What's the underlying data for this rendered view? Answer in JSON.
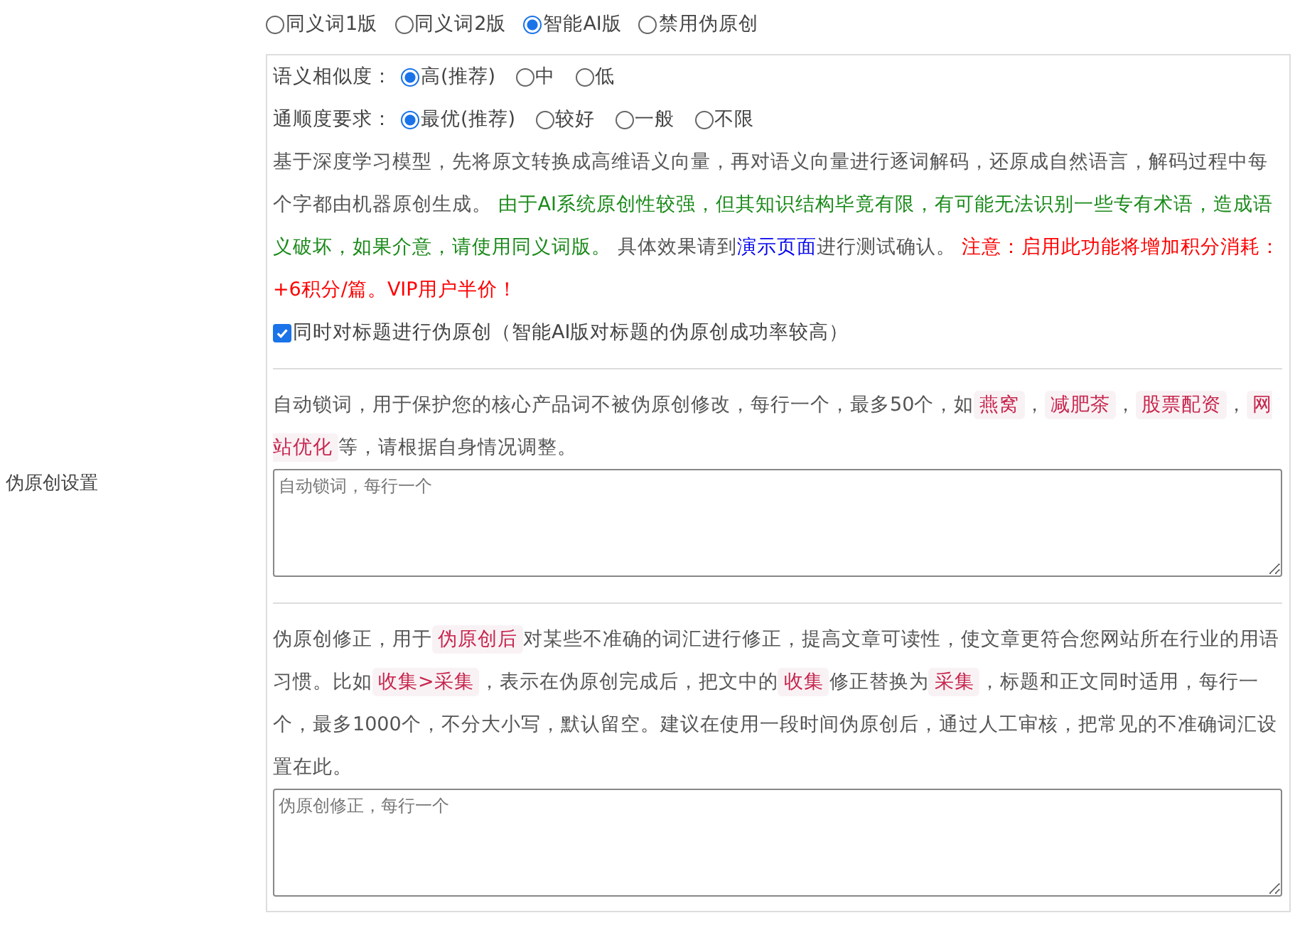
{
  "modes": [
    {
      "label": "同义词1版",
      "selected": false
    },
    {
      "label": "同义词2版",
      "selected": false
    },
    {
      "label": "智能AI版",
      "selected": true
    },
    {
      "label": "禁用伪原创",
      "selected": false
    }
  ],
  "similarity": {
    "label": "语义相似度：",
    "options": [
      {
        "label": "高(推荐)",
        "selected": true
      },
      {
        "label": "中",
        "selected": false
      },
      {
        "label": "低",
        "selected": false
      }
    ]
  },
  "fluency": {
    "label": "通顺度要求：",
    "options": [
      {
        "label": "最优(推荐)",
        "selected": true
      },
      {
        "label": "较好",
        "selected": false
      },
      {
        "label": "一般",
        "selected": false
      },
      {
        "label": "不限",
        "selected": false
      }
    ]
  },
  "description": [
    {
      "kind": "plain",
      "text": "基于深度学习模型，先将原文转换成高维语义向量，再对语义向量进行逐词解码，还原成自然语言，解码过程中每个字都由机器原创生成。 "
    },
    {
      "kind": "notice",
      "text": "由于AI系统原创性较强，但其知识结构毕竟有限，有可能无法识别一些专有术语，造成语义破坏，如果介意，请使用同义词版。"
    },
    {
      "kind": "plain",
      "text": " 具体效果请到"
    },
    {
      "kind": "link",
      "text": "演示页面"
    },
    {
      "kind": "plain",
      "text": "进行测试确认。 "
    },
    {
      "kind": "warning",
      "text": "注意：启用此功能将增加积分消耗：+6积分/篇。VIP用户半价！"
    }
  ],
  "title_option": {
    "label": "同时对标题进行伪原创（智能AI版对标题的伪原创成功率较高）",
    "checked": true
  },
  "settings_label": "伪原创设置",
  "lock_words": {
    "segments": [
      {
        "kind": "text",
        "text": "自动锁词，用于保护您的核心产品词不被伪原创修改，每行一个，最多50个，如"
      },
      {
        "kind": "tag",
        "text": "燕窝"
      },
      {
        "kind": "text",
        "text": "，"
      },
      {
        "kind": "tag",
        "text": "减肥茶"
      },
      {
        "kind": "text",
        "text": "，"
      },
      {
        "kind": "tag",
        "text": "股票配资"
      },
      {
        "kind": "text",
        "text": "，"
      },
      {
        "kind": "tag",
        "text": "网站优化"
      },
      {
        "kind": "text",
        "text": "等，请根据自身情况调整。"
      }
    ],
    "placeholder": "自动锁词，每行一个"
  },
  "corrections": {
    "segments": [
      {
        "kind": "text",
        "text": "伪原创修正，用于"
      },
      {
        "kind": "tag",
        "text": "伪原创后"
      },
      {
        "kind": "text",
        "text": "对某些不准确的词汇进行修正，提高文章可读性，使文章更符合您网站所在行业的用语习惯。比如"
      },
      {
        "kind": "tag",
        "text": "收集>采集"
      },
      {
        "kind": "text",
        "text": "，表示在伪原创完成后，把文中的"
      },
      {
        "kind": "tag",
        "text": "收集"
      },
      {
        "kind": "text",
        "text": "修正替换为"
      },
      {
        "kind": "tag",
        "text": "采集"
      },
      {
        "kind": "text",
        "text": "，标题和正文同时适用，每行一个，最多1000个，不分大小写，默认留空。建议在使用一段时间伪原创后，通过人工审核，把常见的不准确词汇设置在此。"
      }
    ],
    "placeholder": "伪原创修正，每行一个"
  }
}
